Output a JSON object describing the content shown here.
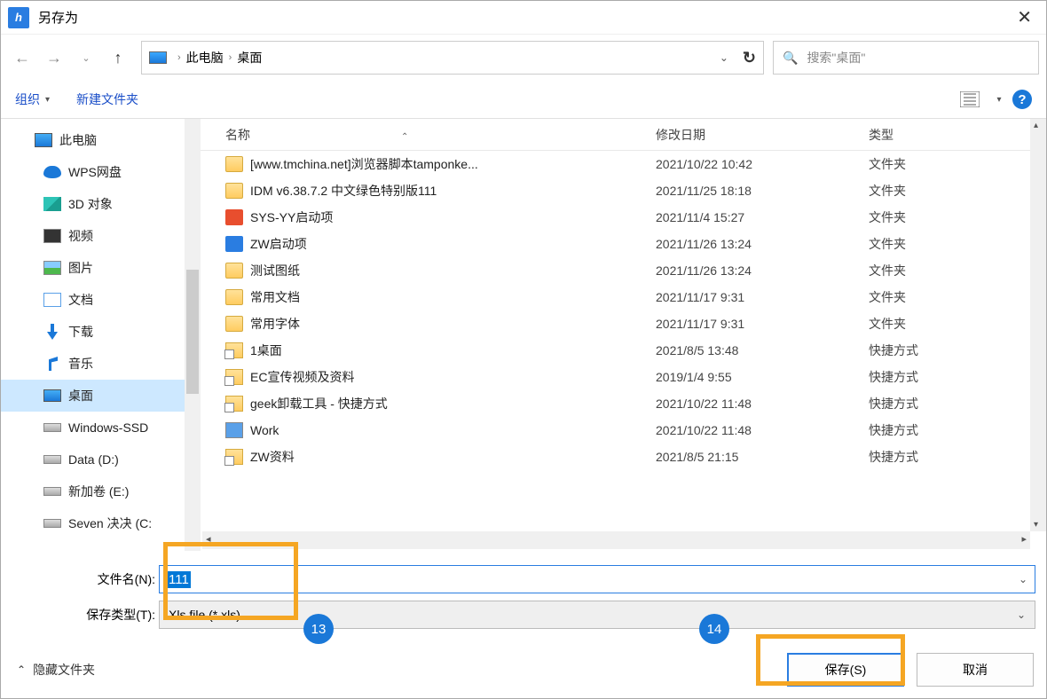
{
  "title": "另存为",
  "breadcrumb": {
    "root": "此电脑",
    "leaf": "桌面"
  },
  "search_placeholder": "搜索\"桌面\"",
  "toolbar": {
    "organize": "组织",
    "new_folder": "新建文件夹"
  },
  "tree": {
    "root": "此电脑",
    "items": [
      {
        "label": "WPS网盘",
        "icon": "cloud"
      },
      {
        "label": "3D 对象",
        "icon": "cube"
      },
      {
        "label": "视频",
        "icon": "video"
      },
      {
        "label": "图片",
        "icon": "pic"
      },
      {
        "label": "文档",
        "icon": "doc"
      },
      {
        "label": "下载",
        "icon": "dl"
      },
      {
        "label": "音乐",
        "icon": "music"
      },
      {
        "label": "桌面",
        "icon": "desktop"
      },
      {
        "label": "Windows-SSD",
        "icon": "disk"
      },
      {
        "label": "Data (D:)",
        "icon": "disk"
      },
      {
        "label": "新加卷 (E:)",
        "icon": "disk"
      },
      {
        "label": "Seven 决决 (C:",
        "icon": "disk"
      }
    ],
    "selected_index": 7
  },
  "columns": {
    "name": "名称",
    "date": "修改日期",
    "type": "类型"
  },
  "files": [
    {
      "icon": "folder",
      "name": "[www.tmchina.net]浏览器脚本tamponke...",
      "date": "2021/10/22 10:42",
      "type": "文件夹"
    },
    {
      "icon": "folder",
      "name": "IDM v6.38.7.2  中文绿色特别版111",
      "date": "2021/11/25 18:18",
      "type": "文件夹"
    },
    {
      "icon": "logo",
      "name": "SYS-YY启动项",
      "date": "2021/11/4 15:27",
      "type": "文件夹"
    },
    {
      "icon": "zw",
      "name": "ZW启动项",
      "date": "2021/11/26 13:24",
      "type": "文件夹"
    },
    {
      "icon": "folder",
      "name": "测试图纸",
      "date": "2021/11/26 13:24",
      "type": "文件夹"
    },
    {
      "icon": "folder",
      "name": "常用文档",
      "date": "2021/11/17 9:31",
      "type": "文件夹"
    },
    {
      "icon": "folder",
      "name": "常用字体",
      "date": "2021/11/17 9:31",
      "type": "文件夹"
    },
    {
      "icon": "lnk",
      "name": "1桌面",
      "date": "2021/8/5 13:48",
      "type": "快捷方式"
    },
    {
      "icon": "lnk",
      "name": "EC宣传视频及资料",
      "date": "2019/1/4 9:55",
      "type": "快捷方式"
    },
    {
      "icon": "lnk",
      "name": "geek卸载工具 - 快捷方式",
      "date": "2021/10/22 11:48",
      "type": "快捷方式"
    },
    {
      "icon": "work",
      "name": "Work",
      "date": "2021/10/22 11:48",
      "type": "快捷方式"
    },
    {
      "icon": "lnk",
      "name": "ZW资料",
      "date": "2021/8/5 21:15",
      "type": "快捷方式"
    }
  ],
  "form": {
    "filename_label": "文件名(N):",
    "filename_value": "111",
    "filetype_label": "保存类型(T):",
    "filetype_value": "Xls file (*.xls)"
  },
  "footer": {
    "hide_folders": "隐藏文件夹",
    "save": "保存(S)",
    "cancel": "取消"
  },
  "badges": {
    "b13": "13",
    "b14": "14"
  }
}
